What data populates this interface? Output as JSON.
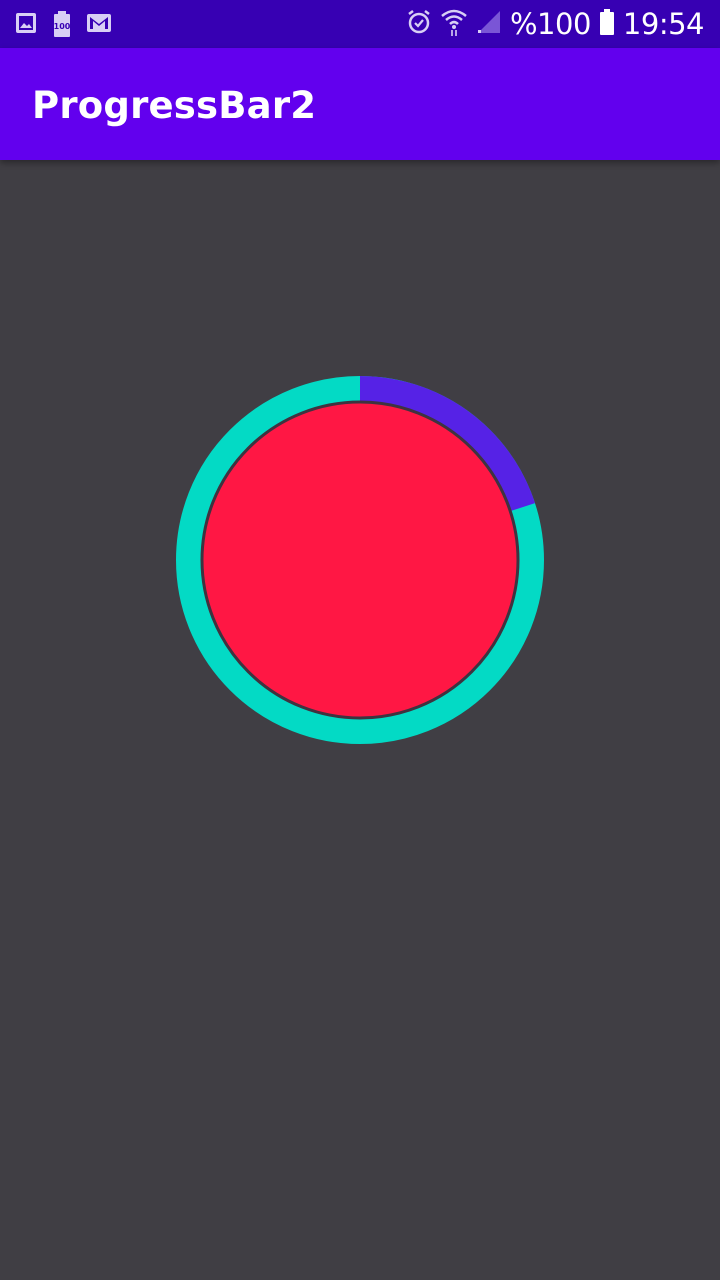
{
  "status_bar": {
    "battery_percent": "%100",
    "time": "19:54",
    "notification_icons": [
      "gallery-icon",
      "battery-100-icon",
      "gmail-icon"
    ],
    "system_icons": [
      "alarm-icon",
      "wifi-icon",
      "signal-icon",
      "battery-icon"
    ]
  },
  "app_bar": {
    "title": "ProgressBar2"
  },
  "progress": {
    "value_fraction": 0.2,
    "track_color": "#03dac5",
    "progress_color": "#5622e6",
    "center_color": "#ff1744"
  },
  "colors": {
    "status_bar": "#3700b3",
    "app_bar": "#6200ee",
    "background": "#403e44"
  }
}
